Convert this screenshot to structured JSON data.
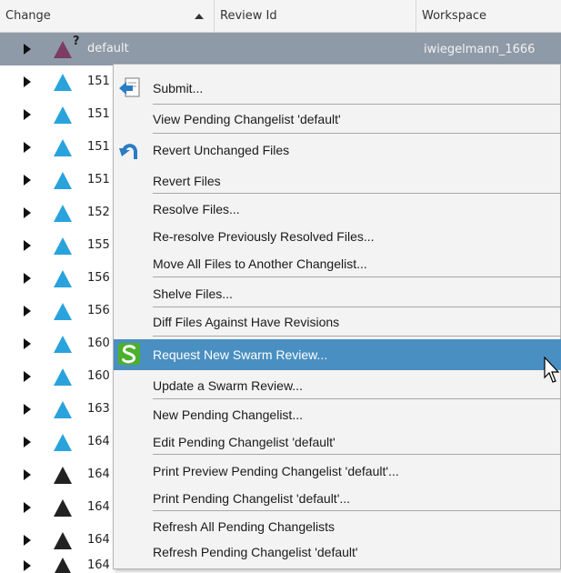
{
  "columns": {
    "change": "Change",
    "review_id": "Review Id",
    "workspace": "Workspace"
  },
  "rows": [
    {
      "change": "default",
      "workspace": "iwiegelmann_1666",
      "icon": "pending-default-icon"
    },
    {
      "change": "151",
      "icon": "pending-changelist-icon"
    },
    {
      "change": "151",
      "icon": "pending-changelist-icon"
    },
    {
      "change": "151",
      "icon": "pending-changelist-icon"
    },
    {
      "change": "151",
      "icon": "pending-changelist-icon"
    },
    {
      "change": "152",
      "icon": "pending-changelist-icon"
    },
    {
      "change": "155",
      "icon": "pending-changelist-icon"
    },
    {
      "change": "156",
      "icon": "pending-changelist-icon"
    },
    {
      "change": "156",
      "icon": "pending-changelist-icon"
    },
    {
      "change": "160",
      "icon": "pending-changelist-icon"
    },
    {
      "change": "160",
      "icon": "pending-changelist-icon"
    },
    {
      "change": "163",
      "icon": "pending-changelist-icon"
    },
    {
      "change": "164",
      "icon": "pending-changelist-icon"
    },
    {
      "change": "164",
      "icon": "other-user-changelist-icon"
    },
    {
      "change": "164",
      "icon": "other-user-changelist-icon"
    },
    {
      "change": "164",
      "icon": "other-user-changelist-icon"
    },
    {
      "change": "164",
      "icon": "other-user-changelist-icon"
    }
  ],
  "menu": {
    "items": [
      {
        "label": "Submit...",
        "icon": "submit-icon"
      },
      {
        "label": "View Pending Changelist 'default'"
      },
      {
        "label": "Revert Unchanged Files",
        "icon": "revert-icon"
      },
      {
        "label": "Revert Files"
      },
      {
        "label": "Resolve Files..."
      },
      {
        "label": "Re-resolve Previously Resolved Files..."
      },
      {
        "label": "Move All Files to Another Changelist..."
      },
      {
        "label": "Shelve Files..."
      },
      {
        "label": "Diff Files Against Have Revisions"
      },
      {
        "label": "Request New Swarm Review...",
        "icon": "swarm-icon",
        "highlighted": true
      },
      {
        "label": "Update a Swarm Review..."
      },
      {
        "label": "New Pending Changelist..."
      },
      {
        "label": "Edit Pending Changelist 'default'"
      },
      {
        "label": "Print Preview Pending Changelist 'default'..."
      },
      {
        "label": "Print Pending Changelist 'default'..."
      },
      {
        "label": "Refresh All Pending Changelists"
      },
      {
        "label": "Refresh Pending Changelist 'default'"
      }
    ]
  },
  "colors": {
    "highlight": "#4a8fc1",
    "selected_row": "#8f9aa8",
    "changelist_blue": "#2aa3dd",
    "swarm_green": "#4caf2e"
  }
}
